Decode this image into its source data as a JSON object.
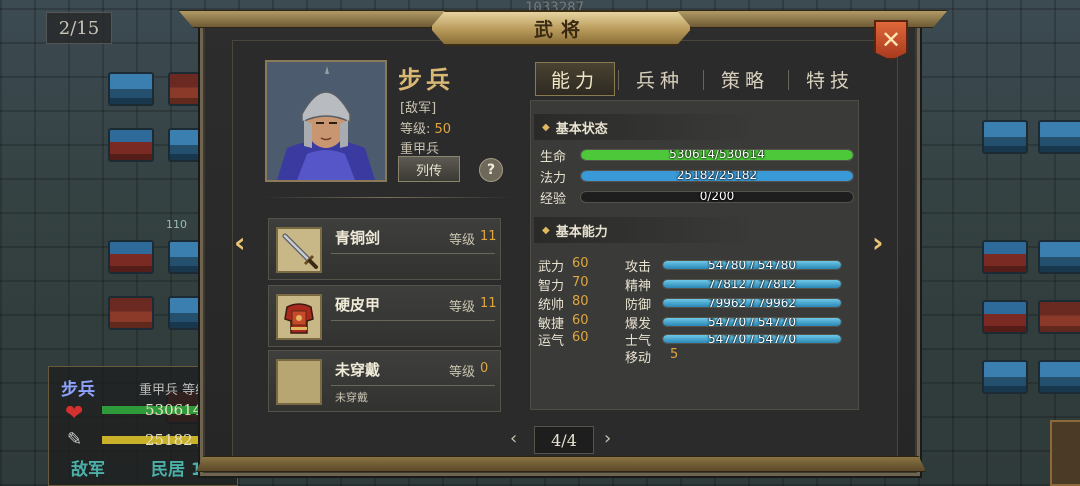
{
  "hud": {
    "turn_counter": "2/15",
    "top_number": "1033287",
    "map_tile_number": "110"
  },
  "unit_panel": {
    "name": "步兵",
    "type_and_level": "重甲兵  等级 5",
    "hp": "530614 /",
    "mp": "25182 /",
    "faction": "敌军",
    "terrain": "民居 1"
  },
  "dialog": {
    "title": "武将",
    "close_icon": "close-x-icon"
  },
  "character": {
    "name": "步兵",
    "faction": "[敌军]",
    "level_label": "等级:",
    "level": "50",
    "class": "重甲兵",
    "bio_button": "列传",
    "help_button": "?"
  },
  "equipment": [
    {
      "name": "青铜剑",
      "level_label": "等级",
      "level": "11",
      "subtext": "",
      "icon": "sword-icon"
    },
    {
      "name": "硬皮甲",
      "level_label": "等级",
      "level": "11",
      "subtext": "",
      "icon": "armor-icon"
    },
    {
      "name": "未穿戴",
      "level_label": "等级",
      "level": "0",
      "subtext": "未穿戴",
      "icon": "empty-slot-icon"
    }
  ],
  "pager": {
    "prev": "‹",
    "label": "4/4",
    "next": "›"
  },
  "tabs": [
    {
      "label": "能力",
      "active": true
    },
    {
      "label": "兵种",
      "active": false
    },
    {
      "label": "策略",
      "active": false
    },
    {
      "label": "特技",
      "active": false
    }
  ],
  "basic_status": {
    "heading": "基本状态",
    "bars": [
      {
        "label": "生命",
        "value": "530614/530614",
        "fraction": 1.0,
        "color": "#4cc83a"
      },
      {
        "label": "法力",
        "value": "25182/25182",
        "fraction": 1.0,
        "color": "#3a9ad8"
      },
      {
        "label": "经验",
        "value": "0/200",
        "fraction": 0.0,
        "color": "#d8b840"
      }
    ]
  },
  "basic_ability": {
    "heading": "基本能力",
    "attributes": [
      {
        "label": "武力",
        "value": "60"
      },
      {
        "label": "智力",
        "value": "70"
      },
      {
        "label": "统帅",
        "value": "80"
      },
      {
        "label": "敏捷",
        "value": "60"
      },
      {
        "label": "运气",
        "value": "60"
      }
    ],
    "combat": [
      {
        "label": "攻击",
        "value": "54780 / 54780",
        "fraction": 1.0
      },
      {
        "label": "精神",
        "value": "77812 / 77812",
        "fraction": 1.0
      },
      {
        "label": "防御",
        "value": "79962 / 79962",
        "fraction": 1.0
      },
      {
        "label": "爆发",
        "value": "54770 / 54770",
        "fraction": 1.0
      },
      {
        "label": "士气",
        "value": "54770 / 54770",
        "fraction": 1.0
      }
    ],
    "move_label": "移动",
    "move_value": "5"
  }
}
